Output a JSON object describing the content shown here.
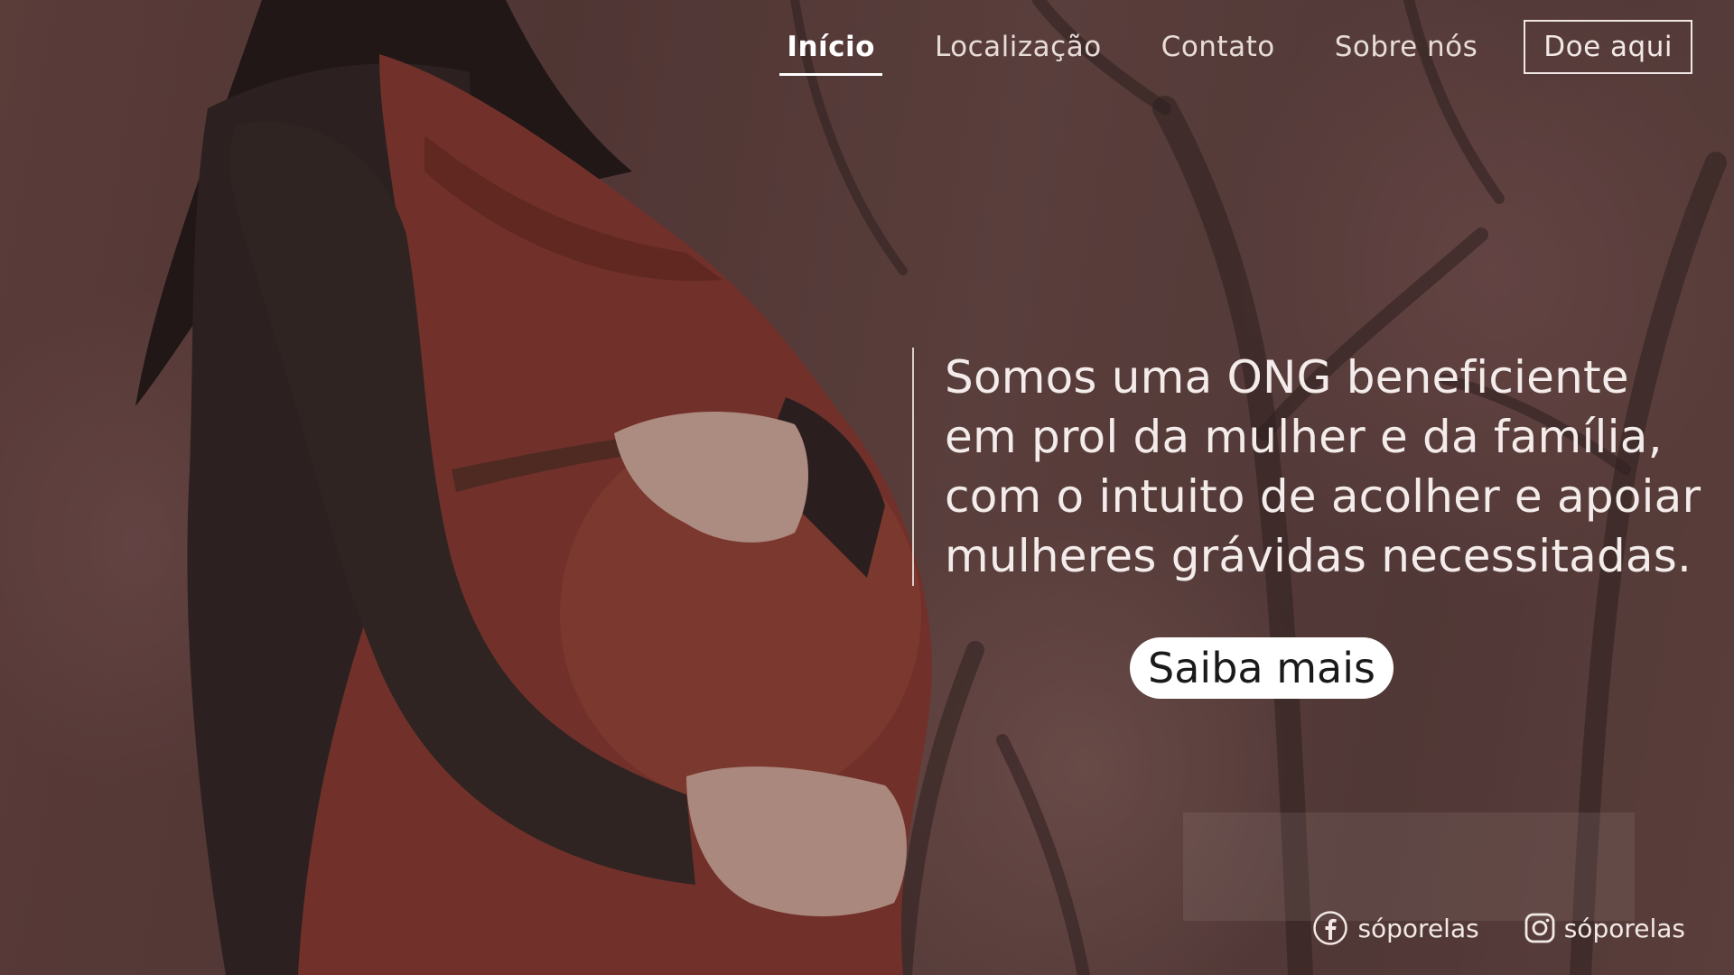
{
  "nav": {
    "items": [
      {
        "label": "Início",
        "active": true
      },
      {
        "label": "Localização",
        "active": false
      },
      {
        "label": "Contato",
        "active": false
      },
      {
        "label": "Sobre nós",
        "active": false
      }
    ],
    "cta_label": "Doe aqui"
  },
  "hero": {
    "text": "Somos uma ONG beneficiente\nem prol da mulher e da família,\ncom o intuito de acolher e apoiar\nmulheres grávidas necessitadas.",
    "button_label": "Saiba mais"
  },
  "social": {
    "facebook": {
      "icon": "facebook-icon",
      "handle": "sóporelas"
    },
    "instagram": {
      "icon": "instagram-icon",
      "handle": "sóporelas"
    }
  },
  "colors": {
    "text_light": "#f4ecea",
    "button_bg": "#ffffff",
    "dress": "#8a3a30",
    "cardigan": "#2e2523"
  }
}
